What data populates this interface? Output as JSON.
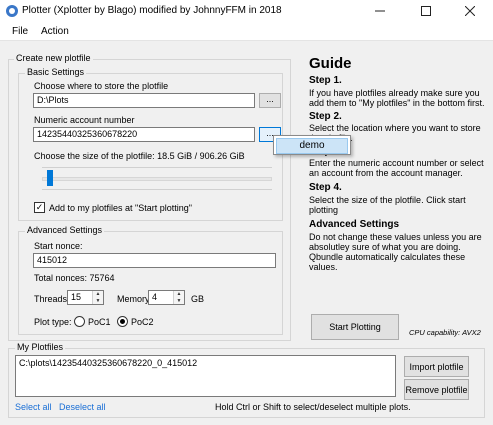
{
  "window": {
    "title": "Plotter (Xplotter by Blago) modified by JohnnyFFM in 2018",
    "minimize_icon": "minimize-icon",
    "maximize_icon": "maximize-icon",
    "close_icon": "close-icon"
  },
  "menu": {
    "file": "File",
    "action": "Action"
  },
  "create": {
    "group_title": "Create new plotfile",
    "basic_title": "Basic Settings",
    "location_label": "Choose where to store the plotfile",
    "location_value": "D:\\Plots",
    "browse_label": "...",
    "account_label": "Numeric account number",
    "account_value": "14235440325360678220",
    "account_button_label": "...",
    "size_label": "Choose the size of the plotfile:  18.5 GiB / 906.26 GiB",
    "size_fraction": 0.02,
    "add_checkbox_label": "Add to my plotfiles at \"Start plotting\"",
    "add_checked": true,
    "check_mark": "✓"
  },
  "account_popup": {
    "item": "demo"
  },
  "advanced": {
    "title": "Advanced Settings",
    "start_nonce_label": "Start nonce:",
    "start_nonce_value": "415012",
    "total_nonces": "Total nonces:  75764",
    "threads_label": "Threads",
    "threads_value": "15",
    "memory_label": "Memory",
    "memory_value": "4",
    "memory_unit": "GB",
    "plot_type_label": "Plot type:",
    "poc1_label": "PoC1",
    "poc2_label": "PoC2",
    "selected_plot_type": "PoC2"
  },
  "guide": {
    "title": "Guide",
    "steps": [
      {
        "heading": "Step 1.",
        "text": "If you have plotfiles already make sure you add them to \"My plotfiles\" in the bottom first."
      },
      {
        "heading": "Step 2.",
        "text": "Select the location where you want to store the plotfile."
      },
      {
        "heading": "Step 3.",
        "text": "Enter the numeric account number or select an account from the account manager."
      },
      {
        "heading": "Step 4.",
        "text": "Select the size of the plotfile. Click start plotting"
      },
      {
        "heading": "Advanced Settings",
        "text": "Do not change these values unless you are absolutley sure of what you are doing. Qbundle automatically calculates these values."
      }
    ]
  },
  "start_button": "Start Plotting",
  "cpu_capability": "CPU capability:  AVX2",
  "my_plotfiles": {
    "title": "My Plotfiles",
    "items": [
      "C:\\plots\\14235440325360678220_0_415012"
    ],
    "import_label": "Import plotfile",
    "remove_label": "Remove plotfile",
    "select_all": "Select all",
    "deselect_all": "Deselect all",
    "hint": "Hold Ctrl or Shift to select/deselect multiple plots."
  },
  "colors": {
    "accent": "#1a6fd6",
    "slider_thumb": "#0078d7",
    "window_bg": "#f0f0f0"
  }
}
